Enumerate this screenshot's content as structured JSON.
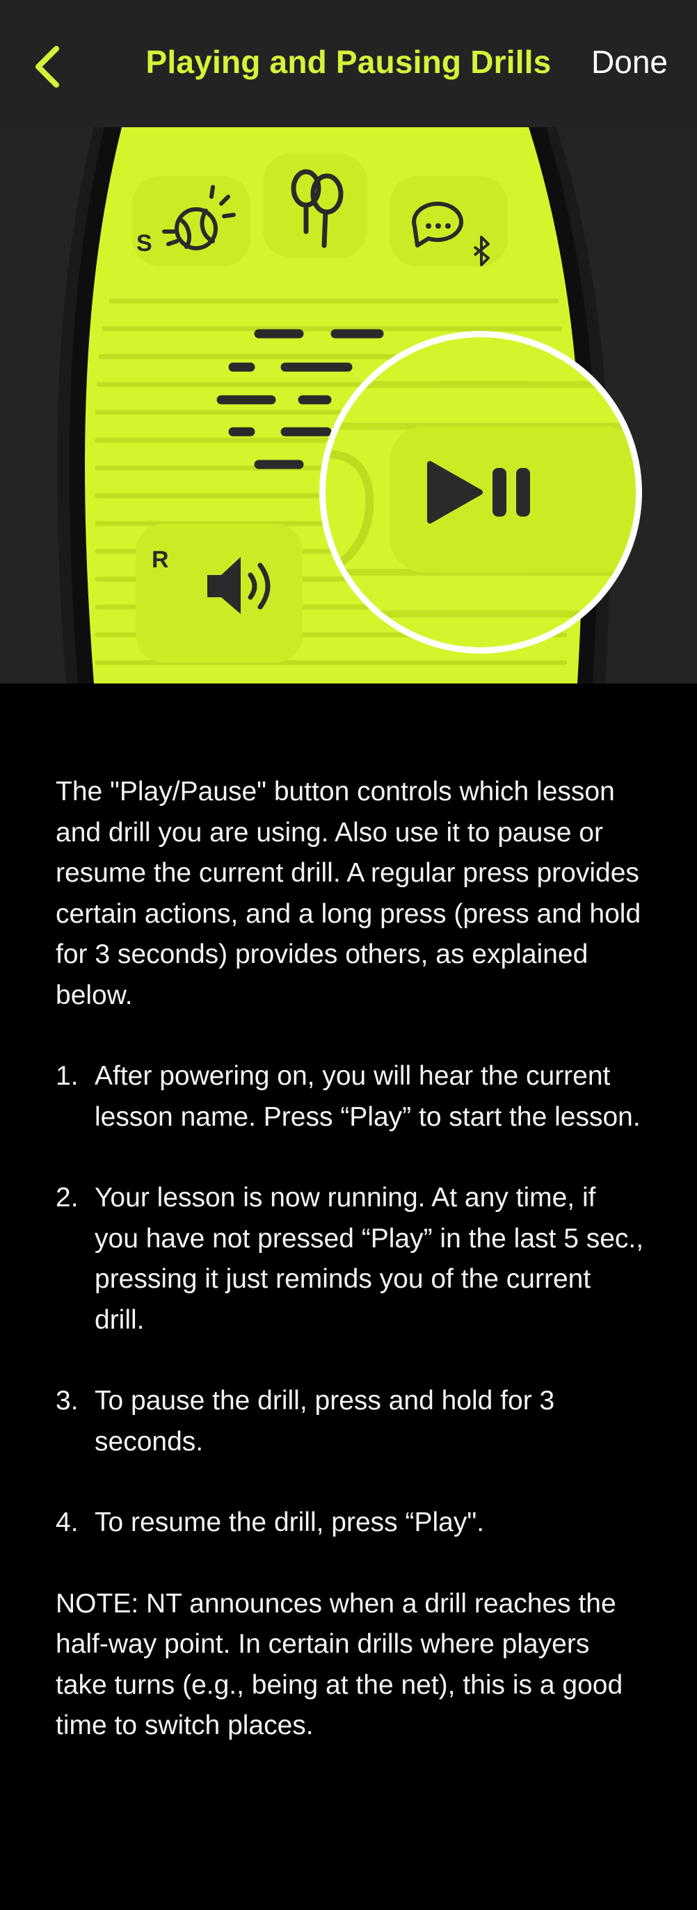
{
  "header": {
    "back_icon": "chevron-left-icon",
    "title": "Playing and Pausing Drills",
    "done_label": "Done"
  },
  "hero": {
    "device_color": "#d4f52c",
    "button_labels": {
      "serve": "S",
      "repeat": "R"
    },
    "icons": [
      "tennis-ball-icon",
      "rackets-icon",
      "chat-bubble-icon",
      "bluetooth-icon",
      "speaker-icon",
      "play-pause-icon"
    ]
  },
  "content": {
    "intro": "The \"Play/Pause\" button controls which lesson and drill you are using. Also use it to pause or resume the current drill. A regular press provides certain actions, and a long press (press and hold for 3 seconds) provides others, as explained below.",
    "steps": [
      {
        "num": "1.",
        "text": "After powering on, you will hear the current lesson name. Press “Play” to start the lesson."
      },
      {
        "num": "2.",
        "text": "Your lesson is now running. At any time, if you have not pressed “Play” in the last 5 sec., pressing it just reminds you of the current drill."
      },
      {
        "num": "3.",
        "text": "To pause the drill, press and hold for 3 seconds."
      },
      {
        "num": "4.",
        "text": "To resume the drill, press “Play\"."
      }
    ],
    "note": "NOTE:  NT announces when a drill reaches the half-way point. In certain drills where players take turns (e.g., being at the net), this is a good time to switch places."
  }
}
